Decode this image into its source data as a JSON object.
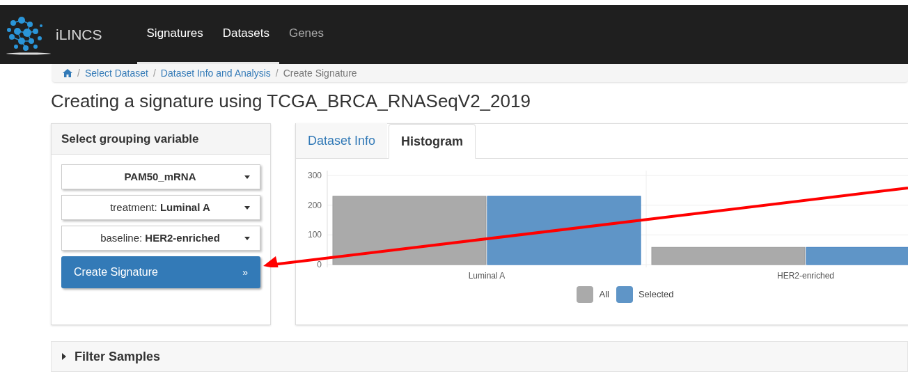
{
  "navbar": {
    "brand": "iLINCS",
    "items": [
      {
        "label": "Signatures",
        "selected": true
      },
      {
        "label": "Datasets",
        "selected": true
      },
      {
        "label": "Genes",
        "selected": false
      }
    ]
  },
  "breadcrumb": [
    {
      "kind": "home"
    },
    {
      "kind": "link",
      "separator": "/",
      "label": "Select Dataset"
    },
    {
      "kind": "link",
      "separator": "/",
      "label": "Dataset Info and Analysis"
    },
    {
      "kind": "current",
      "separator": "/",
      "label": "Create Signature"
    }
  ],
  "page_title": "Creating a signature using TCGA_BRCA_RNASeqV2_2019",
  "grouping_panel": {
    "title": "Select grouping variable",
    "dropdowns": [
      {
        "value": "**PAM50_mRNA**"
      },
      {
        "value": "treatment: **Luminal A**"
      },
      {
        "value": "baseline: **HER2-enriched**"
      }
    ],
    "button": {
      "label": "Create Signature",
      "icon": "»"
    }
  },
  "tabs": [
    {
      "label": "Dataset Info",
      "selected": false
    },
    {
      "label": "Histogram",
      "selected": true
    }
  ],
  "histogram": {
    "chart_data": {
      "type": "bar",
      "categories": [
        "Luminal A",
        "HER2-enriched"
      ],
      "series": [
        {
          "name": "All",
          "color": "#aaaaaa",
          "values": [
            230,
            58
          ]
        },
        {
          "name": "Selected",
          "color": "#5f95c7",
          "values": [
            230,
            58
          ]
        }
      ],
      "ylim": [
        0,
        300
      ],
      "yticks": [
        0,
        100,
        200,
        300
      ]
    }
  },
  "filter_section": {
    "title": "Filter Samples",
    "expanded": false
  }
}
